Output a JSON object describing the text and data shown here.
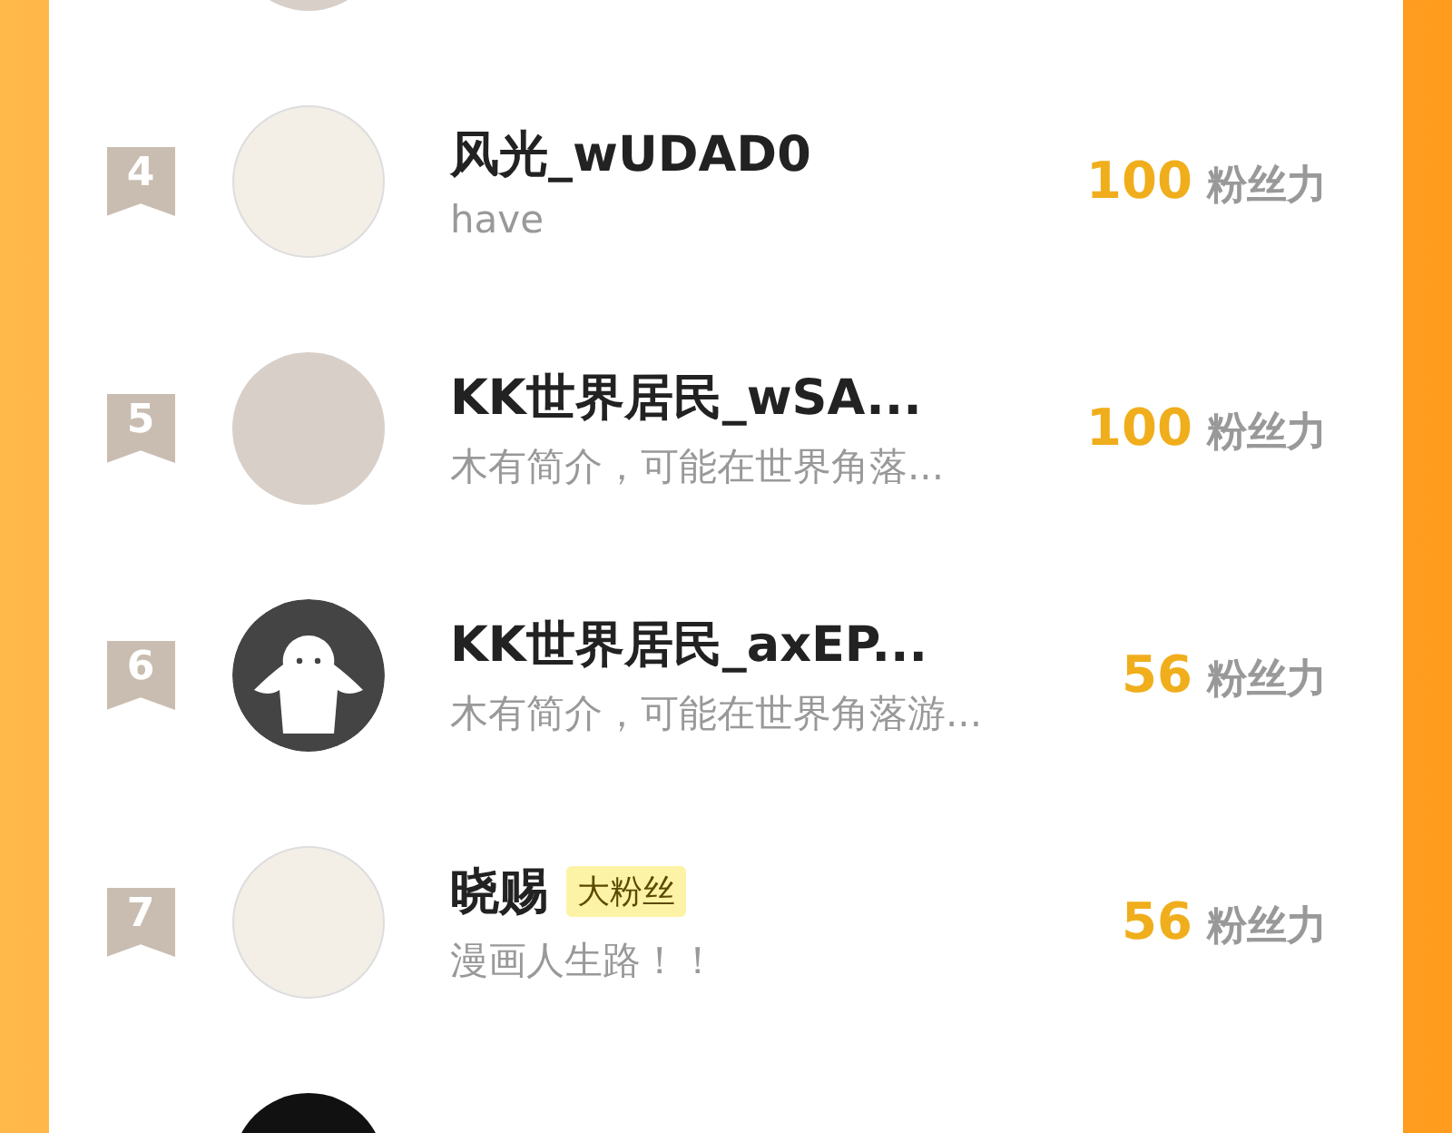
{
  "rows": [
    {
      "avatar": {
        "kind": "photo"
      }
    },
    {
      "rank": "4",
      "avatar": {
        "kind": "drawing"
      },
      "name": "风光_wUDAD0",
      "bio": "have",
      "score": "100",
      "unit": "粉丝力"
    },
    {
      "rank": "5",
      "avatar": {
        "kind": "photo"
      },
      "name": "KK世界居民_wSA...",
      "bio": "木有简介，可能在世界角落...",
      "score": "100",
      "unit": "粉丝力"
    },
    {
      "rank": "6",
      "avatar": {
        "kind": "silhouette"
      },
      "name": "KK世界居民_axEP...",
      "bio": "木有简介，可能在世界角落游...",
      "score": "56",
      "unit": "粉丝力"
    },
    {
      "rank": "7",
      "avatar": {
        "kind": "drawing"
      },
      "name": "晓赐",
      "badge": "大粉丝",
      "bio": "漫画人生路！！",
      "score": "56",
      "unit": "粉丝力"
    },
    {
      "avatar": {
        "kind": "dark"
      }
    }
  ]
}
